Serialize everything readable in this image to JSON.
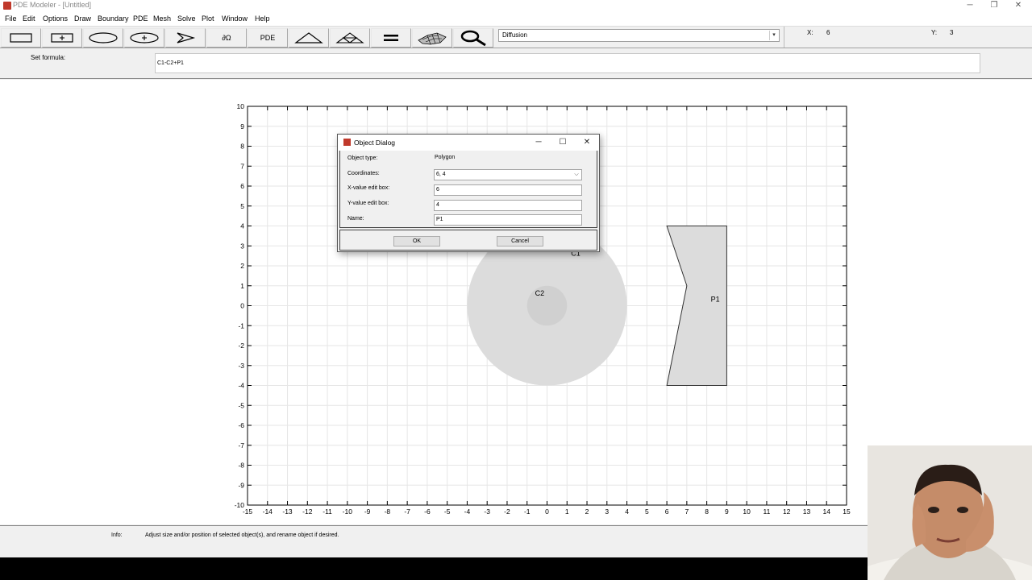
{
  "window": {
    "title": "PDE Modeler - [Untitled]"
  },
  "menu": [
    "File",
    "Edit",
    "Options",
    "Draw",
    "Boundary",
    "PDE",
    "Mesh",
    "Solve",
    "Plot",
    "Window",
    "Help"
  ],
  "toolbar": {
    "buttons": [
      {
        "name": "rectangle-tool",
        "icon": "rectangle-icon"
      },
      {
        "name": "rectangle-center-tool",
        "icon": "rectangle-center-icon"
      },
      {
        "name": "ellipse-tool",
        "icon": "ellipse-icon"
      },
      {
        "name": "ellipse-center-tool",
        "icon": "ellipse-center-icon"
      },
      {
        "name": "polygon-tool",
        "icon": "polygon-icon"
      },
      {
        "name": "boundary-mode-button",
        "label": "∂Ω"
      },
      {
        "name": "pde-spec-button",
        "label": "PDE"
      },
      {
        "name": "init-mesh-button",
        "icon": "triangle-mesh-icon"
      },
      {
        "name": "refine-mesh-button",
        "icon": "refine-mesh-icon"
      },
      {
        "name": "solve-button",
        "icon": "equals-icon"
      },
      {
        "name": "plot-button",
        "icon": "surface-plot-icon"
      },
      {
        "name": "zoom-button",
        "icon": "zoom-icon"
      }
    ],
    "mode_value": "Diffusion",
    "x_label": "X:",
    "x_value": "6",
    "y_label": "Y:",
    "y_value": "3"
  },
  "formula": {
    "label": "Set formula:",
    "value": "C1-C2+P1"
  },
  "plot": {
    "x_range": [
      -15,
      15
    ],
    "y_range": [
      -10,
      10
    ],
    "grid": true,
    "shape_color": "#dcdcdc",
    "shapes": [
      {
        "type": "circle",
        "label": "C1",
        "cx": 0,
        "cy": 0,
        "r": 4
      },
      {
        "type": "circle",
        "label": "C2",
        "cx": 0,
        "cy": 0,
        "r": 1
      },
      {
        "type": "polygon",
        "label": "P1",
        "points": [
          [
            6,
            4
          ],
          [
            9,
            4
          ],
          [
            9,
            -4
          ],
          [
            6,
            -4
          ],
          [
            7,
            1
          ]
        ]
      }
    ]
  },
  "info": {
    "label": "Info:",
    "message": "Adjust size and/or position of selected object(s), and rename object if desired."
  },
  "dialog": {
    "title": "Object Dialog",
    "object_type_label": "Object type:",
    "object_type_value": "Polygon",
    "coordinates_label": "Coordinates:",
    "coordinates_value": "6, 4",
    "x_label": "X-value edit box:",
    "x_value": "6",
    "y_label": "Y-value edit box:",
    "y_value": "4",
    "name_label": "Name:",
    "name_value": "P1",
    "ok_label": "OK",
    "cancel_label": "Cancel"
  }
}
